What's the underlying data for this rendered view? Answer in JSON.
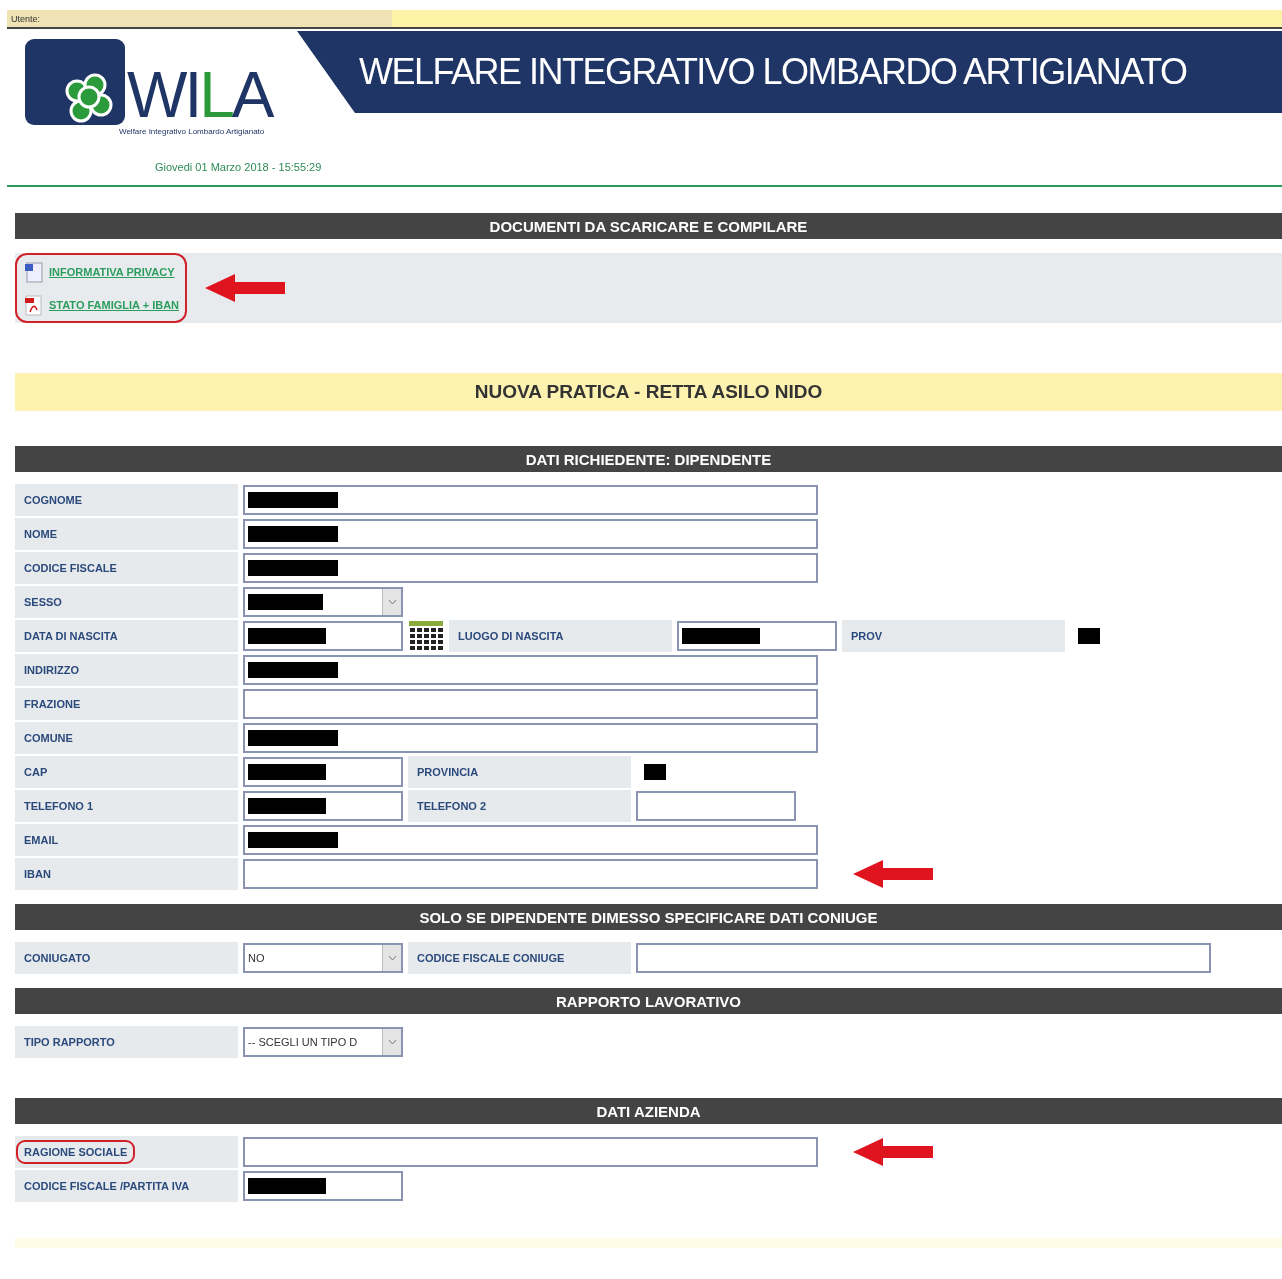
{
  "top_bar": {
    "user_label": "Utente:"
  },
  "header": {
    "logo": {
      "prefix": "WI",
      "accent": "L",
      "suffix": "A",
      "tagline": "Welfare Integrativo Lombardo Artigianato"
    },
    "title": "WELFARE INTEGRATIVO LOMBARDO ARTIGIANATO",
    "date": "Giovedi 01 Marzo 2018 - 15:55:29"
  },
  "documents": {
    "title": "DOCUMENTI DA SCARICARE E COMPILARE",
    "annotated": true,
    "arrow": true,
    "links": [
      {
        "kind": "doc",
        "text": "INFORMATIVA PRIVACY"
      },
      {
        "kind": "pdf",
        "text": "STATO FAMIGLIA + IBAN"
      }
    ]
  },
  "banner": {
    "title": "NUOVA PRATICA - RETTA ASILO NIDO"
  },
  "sections": [
    {
      "title": "DATI RICHIEDENTE: DIPENDENTE",
      "rows": [
        {
          "cells": [
            {
              "kind": "label",
              "text": "COGNOME"
            },
            {
              "kind": "input",
              "redacted": true
            }
          ]
        },
        {
          "cells": [
            {
              "kind": "label",
              "text": "NOME"
            },
            {
              "kind": "input",
              "redacted": true
            }
          ]
        },
        {
          "cells": [
            {
              "kind": "label",
              "text": "CODICE FISCALE"
            },
            {
              "kind": "input",
              "redacted": true
            }
          ]
        },
        {
          "cells": [
            {
              "kind": "label",
              "text": "SESSO"
            },
            {
              "kind": "select",
              "redacted": true
            }
          ]
        },
        {
          "cells": [
            {
              "kind": "label",
              "text": "DATA DI NASCITA"
            },
            {
              "kind": "shortinput",
              "redacted": true
            },
            {
              "kind": "calendar"
            },
            {
              "kind": "label",
              "text": "LUOGO DI NASCITA"
            },
            {
              "kind": "shortinput",
              "redacted": true
            },
            {
              "kind": "label",
              "text": "PROV"
            },
            {
              "kind": "value",
              "redacted": true
            }
          ]
        },
        {
          "cells": [
            {
              "kind": "label",
              "text": "INDIRIZZO"
            },
            {
              "kind": "input",
              "redacted": true
            }
          ]
        },
        {
          "cells": [
            {
              "kind": "label",
              "text": "FRAZIONE"
            },
            {
              "kind": "input",
              "redacted": false
            }
          ]
        },
        {
          "cells": [
            {
              "kind": "label",
              "text": "COMUNE"
            },
            {
              "kind": "input",
              "redacted": true
            }
          ]
        },
        {
          "cells": [
            {
              "kind": "label",
              "text": "CAP"
            },
            {
              "kind": "shortinput",
              "redacted": true
            },
            {
              "kind": "label",
              "text": "PROVINCIA"
            },
            {
              "kind": "value",
              "redacted": true
            }
          ]
        },
        {
          "cells": [
            {
              "kind": "label",
              "text": "TELEFONO 1"
            },
            {
              "kind": "shortinput",
              "redacted": true
            },
            {
              "kind": "label",
              "text": "TELEFONO 2"
            },
            {
              "kind": "shortinput",
              "redacted": false
            }
          ]
        },
        {
          "cells": [
            {
              "kind": "label",
              "text": "EMAIL"
            },
            {
              "kind": "input",
              "redacted": true
            }
          ]
        },
        {
          "arrow": true,
          "cells": [
            {
              "kind": "label",
              "text": "IBAN"
            },
            {
              "kind": "input",
              "redacted": false
            }
          ]
        }
      ]
    },
    {
      "title": "SOLO SE DIPENDENTE DIMESSO SPECIFICARE DATI CONIUGE",
      "rows": [
        {
          "cells": [
            {
              "kind": "label",
              "text": "CONIUGATO"
            },
            {
              "kind": "select",
              "value": "NO",
              "redacted": false
            },
            {
              "kind": "label",
              "text": "CODICE FISCALE CONIUGE"
            },
            {
              "kind": "input",
              "redacted": false
            }
          ]
        }
      ]
    },
    {
      "title": "RAPPORTO LAVORATIVO",
      "rows": [
        {
          "cells": [
            {
              "kind": "label",
              "text": "TIPO RAPPORTO"
            },
            {
              "kind": "select",
              "value": "-- SCEGLI UN TIPO D",
              "redacted": false
            }
          ]
        }
      ]
    },
    {
      "title": "DATI AZIENDA",
      "rows": [
        {
          "arrow": true,
          "cells": [
            {
              "kind": "label",
              "text": "RAGIONE SOCIALE",
              "annotated": true
            },
            {
              "kind": "input",
              "redacted": false
            }
          ]
        },
        {
          "cells": [
            {
              "kind": "label",
              "text": "CODICE FISCALE /PARTITA IVA"
            },
            {
              "kind": "shortinput",
              "redacted": true
            }
          ]
        }
      ]
    }
  ]
}
